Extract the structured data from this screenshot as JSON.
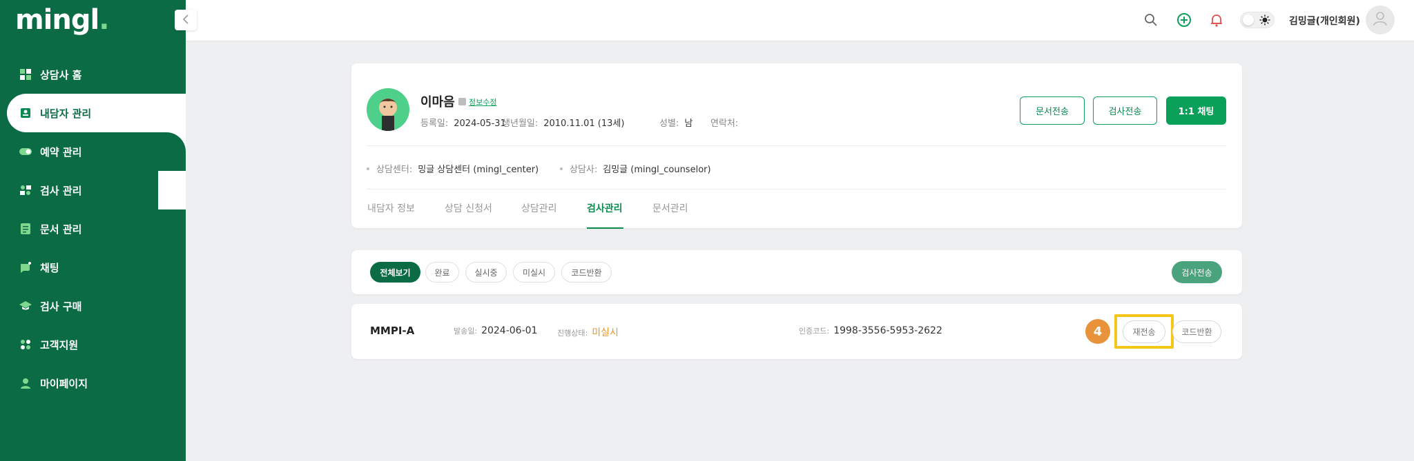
{
  "logo": {
    "text": "mingl",
    "dot": "."
  },
  "sidebar": {
    "items": [
      {
        "label": "상담사 홈",
        "icon": "dashboard-icon"
      },
      {
        "label": "내담자 관리",
        "icon": "contact-card-icon"
      },
      {
        "label": "예약 관리",
        "icon": "toggle-calendar-icon"
      },
      {
        "label": "검사 관리",
        "icon": "test-grid-icon"
      },
      {
        "label": "문서 관리",
        "icon": "document-icon"
      },
      {
        "label": "채팅",
        "icon": "chat-icon"
      },
      {
        "label": "검사 구매",
        "icon": "graduation-cap-icon"
      },
      {
        "label": "고객지원",
        "icon": "support-icon"
      },
      {
        "label": "마이페이지",
        "icon": "person-icon"
      }
    ]
  },
  "header": {
    "user_name": "김밍글(개인회원)"
  },
  "profile": {
    "name": "이마음",
    "edit_link": "정보수정",
    "reg_label": "등록일:",
    "reg_value": "2024-05-31",
    "birth_label": "생년월일:",
    "birth_value": "2010.11.01 (13세)",
    "gender_label": "성별:",
    "gender_value": "남",
    "phone_label": "연락처:",
    "phone_value": "",
    "center_label": "상담센터:",
    "center_value": "밍글 상담센터 (mingl_center)",
    "counselor_label": "상담사:",
    "counselor_value": "김밍글 (mingl_counselor)",
    "buttons": {
      "doc_send": "문서전송",
      "test_send": "검사전송",
      "chat": "1:1 채팅"
    }
  },
  "tabs": [
    "내담자 정보",
    "상담 신청서",
    "상담관리",
    "검사관리",
    "문서관리"
  ],
  "filters": {
    "chips": [
      "전체보기",
      "완료",
      "실시중",
      "미실시",
      "코드반환"
    ],
    "send_button": "검사전송"
  },
  "test_row": {
    "name": "MMPI-A",
    "sent_label": "발송일:",
    "sent_value": "2024-06-01",
    "status_label": "진행상태:",
    "status_value": "미실시",
    "code_label": "인증코드:",
    "code_value": "1998-3556-5953-2622",
    "step_badge": "4",
    "resend_button": "재전송",
    "code_return_button": "코드반환"
  },
  "colors": {
    "brand": "#0a6b45",
    "accent": "#0aa05a",
    "warning": "#e8952c",
    "highlight": "#f5c518"
  }
}
